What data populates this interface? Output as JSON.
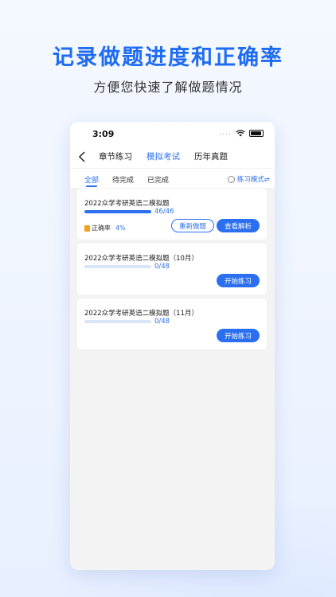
{
  "headline": "记录做题进度和正确率",
  "subline": "方便您快速了解做题情况",
  "status_bar": {
    "time": "3:09",
    "signal": "...."
  },
  "nav": {
    "tabs": [
      {
        "label": "章节练习"
      },
      {
        "label": "模拟考试",
        "active": true
      },
      {
        "label": "历年真题"
      }
    ]
  },
  "filters": {
    "items": [
      {
        "label": "全部",
        "active": true
      },
      {
        "label": "待完成"
      },
      {
        "label": "已完成"
      }
    ],
    "mode_label": "练习模式⇌"
  },
  "cards": [
    {
      "title": "2022众学考研英语二模拟题",
      "progress_text": "46/46",
      "progress": 1.0,
      "accuracy_label": "正确率",
      "accuracy_value": "4%",
      "buttons": [
        "重新做题",
        "查看解析"
      ]
    },
    {
      "title": "2022众学考研英语二模拟题（10月）",
      "progress_text": "0/48",
      "progress": 0,
      "buttons": [
        "开始练习"
      ]
    },
    {
      "title": "2022众学考研英语二模拟题（11月）",
      "progress_text": "0/48",
      "progress": 0,
      "buttons": [
        "开始练习"
      ]
    }
  ],
  "colors": {
    "accent": "#2a6ff0",
    "headline": "#1f6bf2",
    "accuracy_icon": "#f0a21f"
  }
}
